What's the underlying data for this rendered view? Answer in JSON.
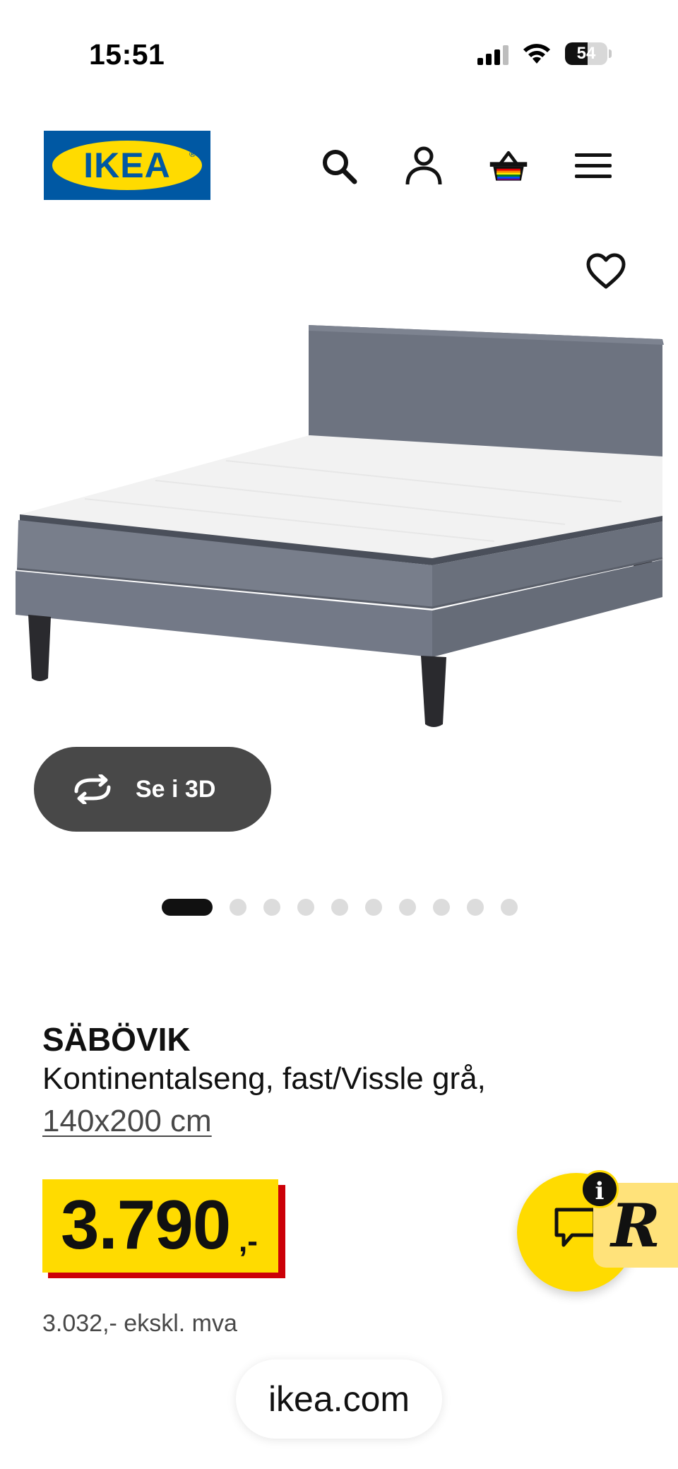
{
  "status_bar": {
    "time": "15:51",
    "battery_level": "54",
    "battery_fraction": 0.54,
    "icons": [
      "signal-icon",
      "wifi-icon",
      "battery-icon"
    ]
  },
  "header": {
    "logo_text": "IKEA",
    "icons": [
      "search-icon",
      "account-icon",
      "basket-icon",
      "menu-icon"
    ]
  },
  "product_image": {
    "favorite_icon": "heart-icon",
    "view_3d_label": "Se i 3D",
    "view_3d_icon": "rotate-icon"
  },
  "carousel": {
    "total": 10,
    "active_index": 0
  },
  "product": {
    "name": "SÄBÖVIK",
    "description": "Kontinentalseng, fast/Vissle grå,",
    "size": "140x200 cm"
  },
  "price": {
    "integer": "3.790",
    "suffix": ",-",
    "excl_vat": "3.032,- ekskl. mva"
  },
  "chat": {
    "info_label": "i",
    "r_label": "R"
  },
  "address_bar": {
    "url": "ikea.com"
  },
  "colors": {
    "ikea_blue": "#0058a3",
    "ikea_yellow": "#ffdb00",
    "price_red": "#cc0008",
    "button_dark": "#484848",
    "dot_inactive": "#dcdcdc"
  }
}
